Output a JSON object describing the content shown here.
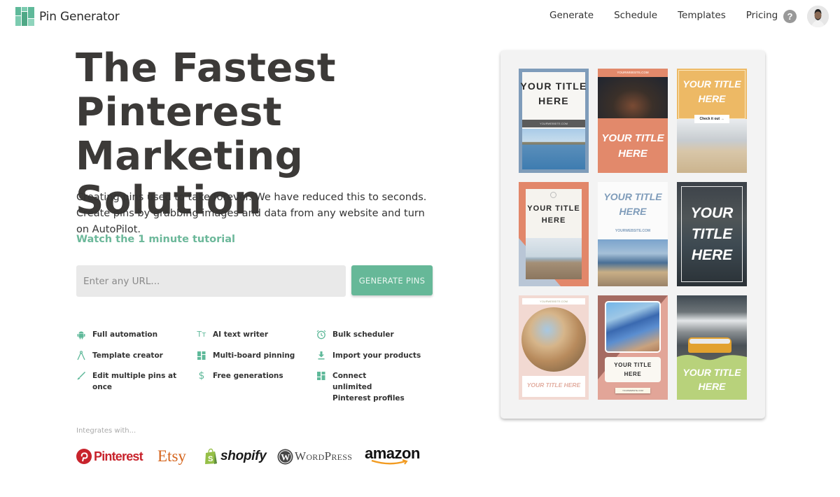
{
  "header": {
    "app_name": "Pin Generator",
    "logo_icon": "grid-logo-icon",
    "nav": [
      "Generate",
      "Schedule",
      "Templates",
      "Pricing"
    ],
    "help_icon": "question-circle-icon",
    "avatar_icon": "user-avatar"
  },
  "hero": {
    "title_lines": [
      "The Fastest",
      "Pinterest Marketing",
      "Solution"
    ],
    "description": "Creating pins used to take forever. We have reduced this to seconds. Create pins by grabbing images and data from any website and turn on AutoPilot.",
    "tutorial_link": "Watch the 1 minute tutorial",
    "url_input": {
      "value": "",
      "placeholder": "Enter any URL..."
    },
    "generate_button": "GENERATE PINS"
  },
  "features": [
    {
      "label": "Full automation",
      "icon": "android-icon"
    },
    {
      "label": "AI text writer",
      "icon": "text-size-icon"
    },
    {
      "label": "Bulk scheduler",
      "icon": "alarm-clock-icon"
    },
    {
      "label": "Template creator",
      "icon": "compass-icon"
    },
    {
      "label": "Multi-board pinning",
      "icon": "dashboard-icon"
    },
    {
      "label": "Import your products",
      "icon": "download-icon"
    },
    {
      "label": "Edit multiple pins at once",
      "icon": "brush-icon"
    },
    {
      "label": "Free generations",
      "icon": "dollar-icon"
    },
    {
      "label": "Connect unlimited Pinterest profiles",
      "icon": "dashboard-icon"
    }
  ],
  "integrations": {
    "label": "Integrates with...",
    "brands": [
      "Pinterest",
      "Etsy",
      "shopify",
      "WordPress",
      "amazon"
    ]
  },
  "pins": [
    {
      "title": "YOUR TITLE HERE",
      "website": "YOURWEBSITE.COM"
    },
    {
      "title": "YOUR TITLE HERE",
      "website": "YOURWEBSITE.COM"
    },
    {
      "title": "YOUR TITLE HERE",
      "cta": "Check it out →"
    },
    {
      "title": "YOUR TITLE HERE"
    },
    {
      "title": "YOUR TITLE HERE",
      "website": "YOURWEBSITE.COM"
    },
    {
      "title": "YOUR TITLE HERE"
    },
    {
      "title": "YOUR TITLE HERE",
      "website": "YOURWEBSITE.COM"
    },
    {
      "title": "YOUR TITLE HERE",
      "website": "YOURWEBSITE.COM"
    },
    {
      "title": "YOUR TITLE HERE"
    }
  ],
  "colors": {
    "accent": "#66b898",
    "heading": "#3c3a38",
    "pinterest_red": "#c8232c",
    "etsy_orange": "#d5641c",
    "shopify_green": "#95bf47",
    "amazon_orange": "#f29b21"
  }
}
